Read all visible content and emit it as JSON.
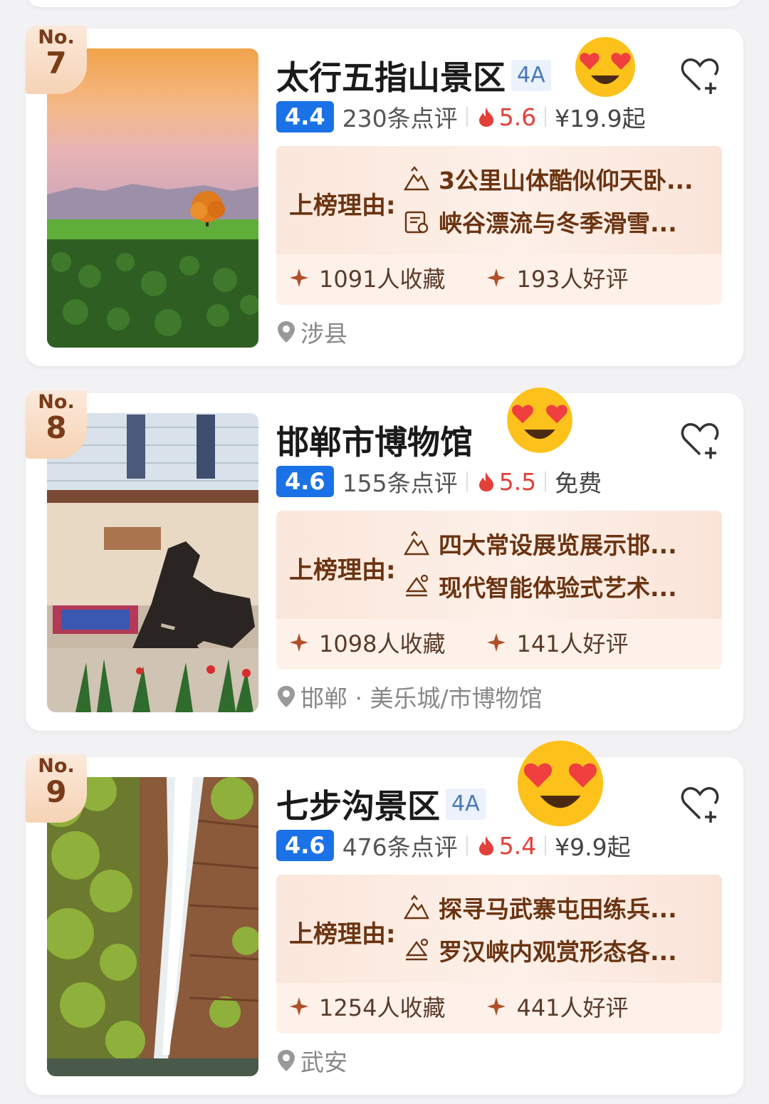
{
  "colors": {
    "score_bg": "#1a72e6",
    "hot": "#e2403a",
    "reason_text": "#6b3412",
    "rank_bg": "#f6d3b5"
  },
  "cards": [
    {
      "rank_prefix": "No.",
      "rank": "7",
      "title": "太行五指山景区",
      "grade": "4A",
      "score": "4.4",
      "reviews": "230条点评",
      "hot": "5.6",
      "price": "¥19.9起",
      "reason_label": "上榜理由:",
      "reasons": [
        "3公里山体酷似仰天卧...",
        "峡谷漂流与冬季滑雪..."
      ],
      "reason_icons": [
        "mountain-icon",
        "ticket-icon"
      ],
      "favorites": "1091人收藏",
      "good_reviews": "193人好评",
      "location": "涉县",
      "image": "sunset-meadow-tree"
    },
    {
      "rank_prefix": "No.",
      "rank": "8",
      "title": "邯郸市博物馆",
      "grade": "",
      "score": "4.6",
      "reviews": "155条点评",
      "hot": "5.5",
      "price": "免费",
      "reason_label": "上榜理由:",
      "reasons": [
        "四大常设展览展示邯...",
        "现代智能体验式艺术..."
      ],
      "reason_icons": [
        "mountain-icon",
        "weather-icon"
      ],
      "favorites": "1098人收藏",
      "good_reviews": "141人好评",
      "location": "邯郸 · 美乐城/市博物馆",
      "image": "museum-hall-horse-statues"
    },
    {
      "rank_prefix": "No.",
      "rank": "9",
      "title": "七步沟景区",
      "grade": "4A",
      "score": "4.6",
      "reviews": "476条点评",
      "hot": "5.4",
      "price": "¥9.9起",
      "reason_label": "上榜理由:",
      "reasons": [
        "探寻马武寨屯田练兵...",
        "罗汉峡内观赏形态各..."
      ],
      "reason_icons": [
        "mountain-icon",
        "weather-icon"
      ],
      "favorites": "1254人收藏",
      "good_reviews": "441人好评",
      "location": "武安",
      "image": "waterfall-cliff"
    }
  ]
}
